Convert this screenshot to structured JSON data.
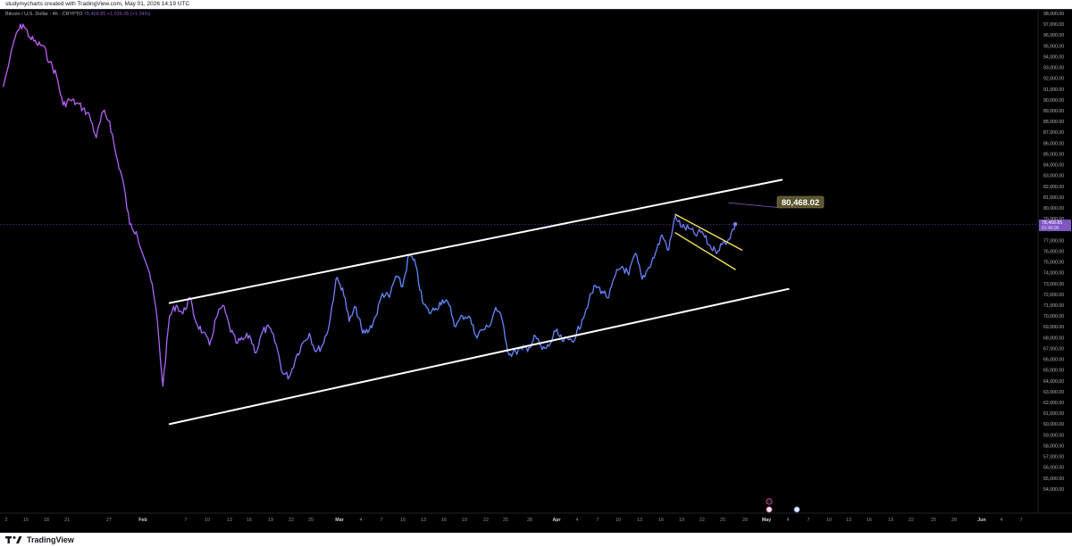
{
  "header": {
    "credit": "studymycharts created with TradingView.com, May 01, 2026 14:19 UTC"
  },
  "legend": {
    "symbol": "Bitcoin / U.S. Dollar · 4h · CRYPTO",
    "price": "78,468.85",
    "change": "+1,036.05 (+1.34%)"
  },
  "footer": {
    "brand": "TradingView"
  },
  "colors": {
    "background": "#000000",
    "price_line_start": "#c45cf2",
    "price_line_end": "#5b8dff",
    "channel": "#ffffff",
    "flag": "#f5e15a",
    "label_bg": "#5c5530",
    "price_tag": "#7e57c2"
  },
  "chart_data": {
    "type": "line",
    "title": "Bitcoin / U.S. Dollar · 4h · CRYPTO",
    "xlabel": "",
    "ylabel": "",
    "ylim": [
      53000,
      98000
    ],
    "grid": false,
    "x_ticks": [
      "2",
      "15",
      "18",
      "21",
      "27",
      "Feb",
      "7",
      "10",
      "13",
      "16",
      "19",
      "22",
      "25",
      "Mar",
      "4",
      "7",
      "10",
      "13",
      "16",
      "19",
      "22",
      "25",
      "28",
      "Apr",
      "4",
      "7",
      "10",
      "13",
      "16",
      "19",
      "22",
      "25",
      "28",
      "May",
      "4",
      "7",
      "10",
      "13",
      "16",
      "19",
      "22",
      "25",
      "28",
      "Jun",
      "4",
      "7"
    ],
    "y_ticks": [
      98000,
      97000,
      96000,
      95000,
      94000,
      93000,
      92000,
      91000,
      90000,
      89000,
      88000,
      87000,
      86000,
      85000,
      84000,
      83000,
      82000,
      81000,
      80000,
      79000,
      78000,
      77000,
      76000,
      75000,
      74000,
      73000,
      72000,
      71000,
      70000,
      69000,
      68000,
      67000,
      66000,
      65000,
      64000,
      63000,
      62000,
      61000,
      60000,
      59000,
      58000,
      57000,
      56000,
      55000,
      54000
    ],
    "current_price": 78468.85,
    "current_price_label": "78,468.85",
    "countdown_label": "01:40:00",
    "series": [
      {
        "x": [
          "Jan 11",
          "Jan 13",
          "Jan 14",
          "Jan 15",
          "Jan 16",
          "Jan 17",
          "Jan 18",
          "Jan 19",
          "Jan 20",
          "Jan 21",
          "Jan 22",
          "Jan 23",
          "Jan 24",
          "Jan 25",
          "Jan 26",
          "Jan 27",
          "Jan 28",
          "Jan 29",
          "Jan 30",
          "Jan 31",
          "Feb 2",
          "Feb 3",
          "Feb 4",
          "Feb 5",
          "Feb 6",
          "Feb 7",
          "Feb 8",
          "Feb 9",
          "Feb 10",
          "Feb 11",
          "Feb 12",
          "Feb 13",
          "Feb 14",
          "Feb 15",
          "Feb 16",
          "Feb 17",
          "Feb 18",
          "Feb 19",
          "Feb 20",
          "Feb 21",
          "Feb 22",
          "Feb 23",
          "Feb 24",
          "Feb 25",
          "Feb 26",
          "Feb 27",
          "Feb 28",
          "Mar 1",
          "Mar 2",
          "Mar 3",
          "Mar 4",
          "Mar 5",
          "Mar 6",
          "Mar 7",
          "Mar 8",
          "Mar 9",
          "Mar 10",
          "Mar 11",
          "Mar 12",
          "Mar 13",
          "Mar 14",
          "Mar 15",
          "Mar 16",
          "Mar 17",
          "Mar 18",
          "Mar 19",
          "Mar 20",
          "Mar 21",
          "Mar 22",
          "Mar 23",
          "Mar 24",
          "Mar 25",
          "Mar 26",
          "Mar 27",
          "Mar 28",
          "Mar 29",
          "Mar 30",
          "Mar 31",
          "Apr 1",
          "Apr 2",
          "Apr 3",
          "Apr 4",
          "Apr 5",
          "Apr 6",
          "Apr 7",
          "Apr 8",
          "Apr 9",
          "Apr 10",
          "Apr 11",
          "Apr 12",
          "Apr 13",
          "Apr 14",
          "Apr 15",
          "Apr 16",
          "Apr 17",
          "Apr 18",
          "Apr 19",
          "Apr 20",
          "Apr 21",
          "Apr 22",
          "Apr 23",
          "Apr 24",
          "Apr 25",
          "Apr 26",
          "Apr 27",
          "Apr 28",
          "Apr 29",
          "Apr 30",
          "May 1"
        ],
        "values": [
          91200,
          96200,
          97000,
          95800,
          95200,
          95000,
          93500,
          92300,
          89500,
          90000,
          89700,
          89200,
          88500,
          86500,
          88900,
          88000,
          84800,
          82500,
          78500,
          77800,
          74000,
          70500,
          63500,
          70000,
          71000,
          70200,
          71700,
          69400,
          68500,
          67300,
          69800,
          71000,
          69000,
          67500,
          67800,
          68200,
          66600,
          68600,
          68900,
          67400,
          64700,
          64400,
          66200,
          67500,
          68400,
          66700,
          67300,
          69200,
          73400,
          72600,
          69500,
          70800,
          68400,
          68700,
          70000,
          72100,
          71700,
          73700,
          72700,
          75700,
          74700,
          71300,
          70300,
          70700,
          71500,
          71000,
          69000,
          70000,
          70000,
          68200,
          68700,
          69000,
          70800,
          69600,
          66400,
          66700,
          66900,
          67100,
          68100,
          66900,
          67200,
          68600,
          67700,
          67800,
          68000,
          69700,
          71400,
          72800,
          72300,
          71700,
          73800,
          74600,
          73800,
          75800,
          73400,
          74500,
          75800,
          77500,
          76100,
          79300,
          78200,
          78100,
          77500,
          77800,
          76600,
          76000,
          76600,
          77100,
          78500
        ]
      }
    ],
    "annotations": [
      {
        "type": "trendline",
        "name": "channel-upper",
        "from": [
          "Feb 5",
          71200
        ],
        "to": [
          "May 8",
          82600
        ]
      },
      {
        "type": "trendline",
        "name": "channel-lower",
        "from": [
          "Feb 5",
          60000
        ],
        "to": [
          "May 9",
          72500
        ]
      },
      {
        "type": "trendline",
        "name": "flag-upper",
        "from": [
          "Apr 22",
          79400
        ],
        "to": [
          "May 2",
          76100
        ]
      },
      {
        "type": "trendline",
        "name": "flag-lower",
        "from": [
          "Apr 22",
          77700
        ],
        "to": [
          "May 1",
          74300
        ]
      },
      {
        "type": "label",
        "text": "80,468.02",
        "anchor": [
          "Apr 30",
          80468.02
        ]
      }
    ]
  }
}
